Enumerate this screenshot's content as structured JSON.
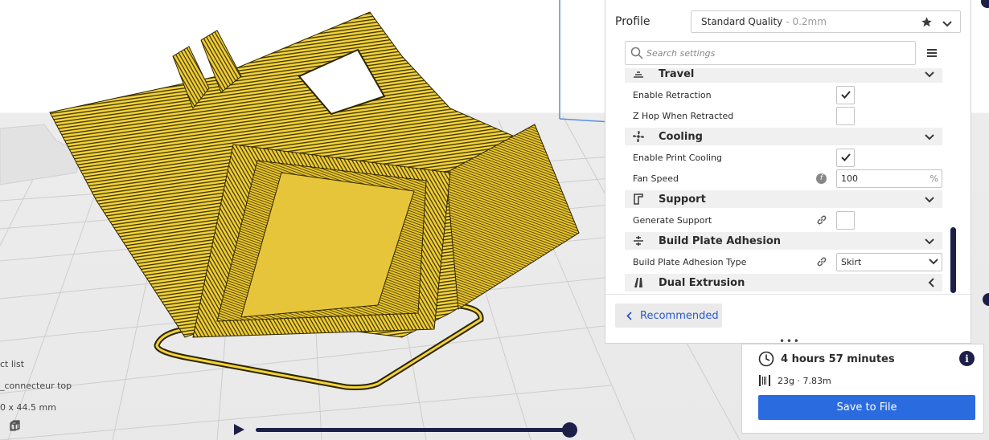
{
  "viewport": {
    "object_list_lines": [
      "ct list",
      "_connecteur top",
      "0 x 44.5 mm"
    ],
    "view_buttons": [
      "cube-3d-icon",
      "cube-front-icon",
      "cube-side-icon"
    ],
    "colors": {
      "model": "#f2d23c",
      "model_dark": "#1a1a1a",
      "slider": "#1d1f49",
      "grid_line": "#c8c8c8"
    }
  },
  "profile": {
    "label": "Profile",
    "value": "Standard Quality",
    "layer_height": "- 0.2mm"
  },
  "search": {
    "placeholder": "Search settings"
  },
  "settings": {
    "travel": {
      "title": "Travel"
    },
    "enable_retraction": {
      "label": "Enable Retraction",
      "checked": true
    },
    "z_hop": {
      "label": "Z Hop When Retracted",
      "checked": false
    },
    "cooling": {
      "title": "Cooling"
    },
    "enable_print_cooling": {
      "label": "Enable Print Cooling",
      "checked": true
    },
    "fan_speed": {
      "label": "Fan Speed",
      "value": "100",
      "unit": "%"
    },
    "support": {
      "title": "Support"
    },
    "generate_support": {
      "label": "Generate Support",
      "checked": false
    },
    "adhesion": {
      "title": "Build Plate Adhesion"
    },
    "adhesion_type": {
      "label": "Build Plate Adhesion Type",
      "value": "Skirt"
    },
    "dual_extrusion": {
      "title": "Dual Extrusion"
    }
  },
  "recommended_button": "Recommended",
  "print_info": {
    "time": "4 hours 57 minutes",
    "material": "23g · 7.83m",
    "save_button": "Save to File",
    "info_glyph": "i"
  },
  "dots": "• • •"
}
